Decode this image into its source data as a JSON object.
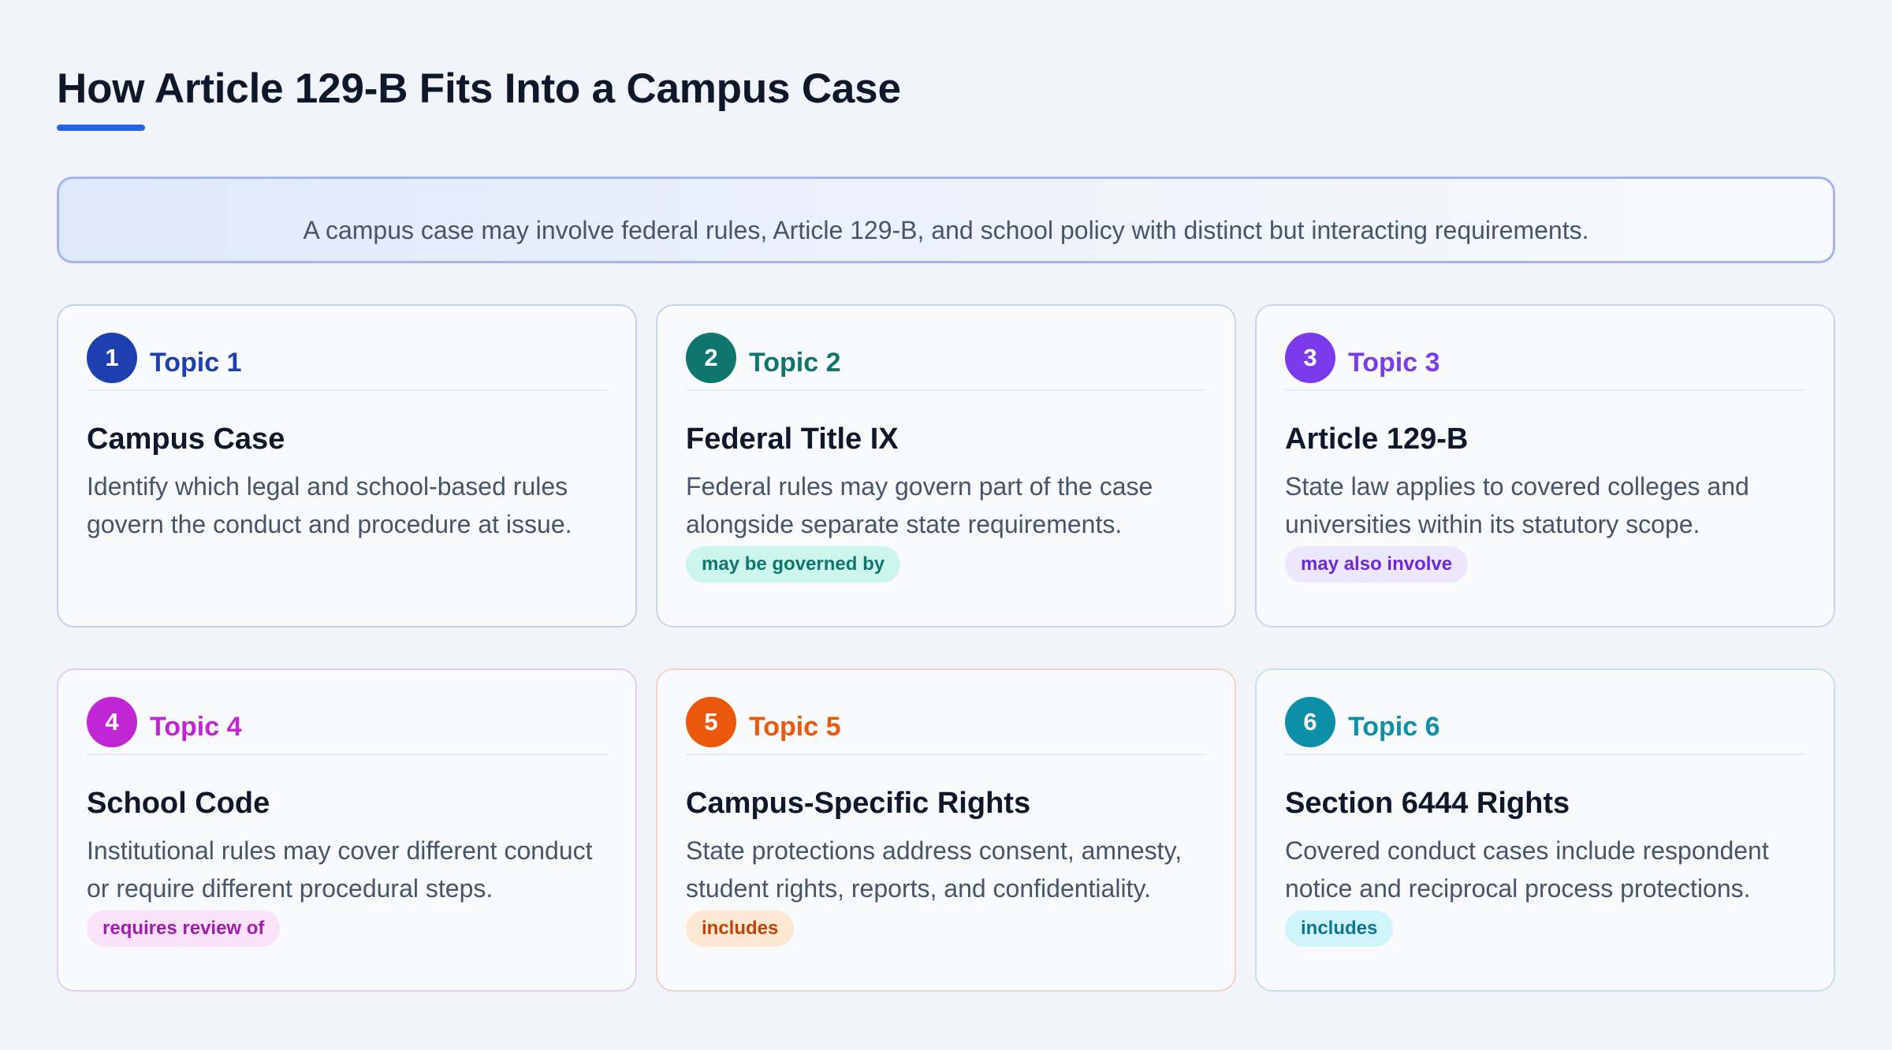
{
  "header": {
    "title": "How Article 129-B Fits Into a Campus Case"
  },
  "intro": {
    "text": "A campus case may involve federal rules, Article 129-B, and school policy with distinct but interacting requirements."
  },
  "cards": [
    {
      "number": "1",
      "topic": "Topic 1",
      "title": "Campus Case",
      "description": "Identify which legal and school-based rules govern the conduct and procedure at issue.",
      "relation": "",
      "accent": "#1e40af",
      "border": "#c7d0ea",
      "pill_bg": "#dbeafe",
      "pill_fg": "#1e40af"
    },
    {
      "number": "2",
      "topic": "Topic 2",
      "title": "Federal Title IX",
      "description": "Federal rules may govern part of the case alongside separate state requirements.",
      "relation": "may be governed by",
      "accent": "#0f766e",
      "border": "#c9d6e6",
      "pill_bg": "#ccf5ec",
      "pill_fg": "#0f766e"
    },
    {
      "number": "3",
      "topic": "Topic 3",
      "title": "Article 129-B",
      "description": "State law applies to covered colleges and universities within its statutory scope.",
      "relation": "may also involve",
      "accent": "#7c3aed",
      "border": "#d6d0ef",
      "pill_bg": "#ede7fd",
      "pill_fg": "#6d28d9"
    },
    {
      "number": "4",
      "topic": "Topic 4",
      "title": "School Code",
      "description": "Institutional rules may cover different conduct or require different procedural steps.",
      "relation": "requires review of",
      "accent": "#c026d3",
      "border": "#e4cdee",
      "pill_bg": "#fae3f8",
      "pill_fg": "#a21caf"
    },
    {
      "number": "5",
      "topic": "Topic 5",
      "title": "Campus-Specific Rights",
      "description": "State protections address consent, amnesty, student rights, reports, and confidentiality.",
      "relation": "includes",
      "accent": "#ea580c",
      "border": "#f0d2c8",
      "pill_bg": "#fde9d3",
      "pill_fg": "#c2410c"
    },
    {
      "number": "6",
      "topic": "Topic 6",
      "title": "Section 6444 Rights",
      "description": "Covered conduct cases include respondent notice and reciprocal process protections.",
      "relation": "includes",
      "accent": "#0e8fa8",
      "border": "#c4e0e8",
      "pill_bg": "#cff5fa",
      "pill_fg": "#0e7490"
    }
  ]
}
